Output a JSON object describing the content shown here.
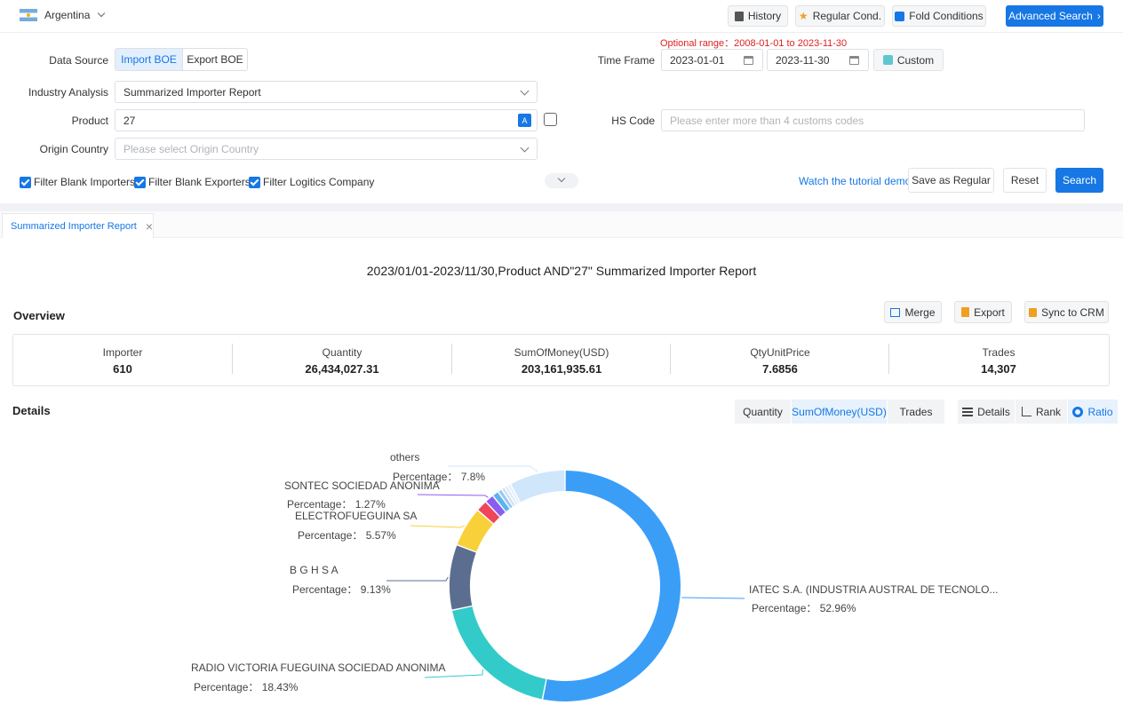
{
  "topbar": {
    "country": "Argentina",
    "buttons": {
      "history": "History",
      "regular": "Regular Cond.",
      "fold": "Fold Conditions",
      "advanced": "Advanced Search"
    }
  },
  "form": {
    "optional_range": "Optional range：2008-01-01 to 2023-11-30",
    "data_source_label": "Data Source",
    "import_boe": "Import BOE",
    "export_boe": "Export BOE",
    "time_frame_label": "Time Frame",
    "date_from": "2023-01-01",
    "date_to": "2023-11-30",
    "custom": "Custom",
    "industry_label": "Industry Analysis",
    "industry_value": "Summarized Importer Report",
    "product_label": "Product",
    "product_value": "27",
    "hs_label": "HS Code",
    "hs_placeholder": "Please enter more than 4 customs codes",
    "origin_label": "Origin Country",
    "origin_placeholder": "Please select Origin Country",
    "filters": [
      "Filter Blank Importers",
      "Filter Blank Exporters",
      "Filter Logitics Company"
    ],
    "tutorial": "Watch the tutorial demo",
    "save_regular": "Save as Regular",
    "reset": "Reset",
    "search": "Search"
  },
  "tab": {
    "label": "Summarized Importer Report",
    "close": "×"
  },
  "report": {
    "title": "2023/01/01-2023/11/30,Product AND\"27\" Summarized Importer Report",
    "overview_heading": "Overview",
    "merge": "Merge",
    "export": "Export",
    "sync": "Sync to CRM",
    "stats": [
      {
        "label": "Importer",
        "value": "610"
      },
      {
        "label": "Quantity",
        "value": "26,434,027.31"
      },
      {
        "label": "SumOfMoney(USD)",
        "value": "203,161,935.61"
      },
      {
        "label": "QtyUnitPrice",
        "value": "7.6856"
      },
      {
        "label": "Trades",
        "value": "14,307"
      }
    ],
    "details_heading": "Details",
    "metric_tabs": [
      "Quantity",
      "SumOfMoney(USD)",
      "Trades"
    ],
    "view_tabs": [
      "Details",
      "Rank",
      "Ratio"
    ]
  },
  "chart_data": {
    "type": "pie",
    "variant": "donut",
    "start_angle_deg": 90,
    "slices": [
      {
        "name": "IATEC S.A. (INDUSTRIA AUSTRAL DE TECNOLO...",
        "value": 52.96,
        "pct_label": "Percentage：  52.96%",
        "color": "#3a9ef7"
      },
      {
        "name": "RADIO VICTORIA FUEGUINA SOCIEDAD ANONIMA",
        "value": 18.43,
        "pct_label": "Percentage：  18.43%",
        "color": "#33cbc9"
      },
      {
        "name": "B G H S A",
        "value": 9.13,
        "pct_label": "Percentage：  9.13%",
        "color": "#5b6e8f"
      },
      {
        "name": "ELECTROFUEGUINA SA",
        "value": 5.57,
        "pct_label": "Percentage：  5.57%",
        "color": "#f8d13a"
      },
      {
        "name": "",
        "value": 1.6,
        "pct_label": "",
        "color": "#f0455a"
      },
      {
        "name": "SONTEC SOCIEDAD ANONIMA",
        "value": 1.27,
        "pct_label": "Percentage：  1.27%",
        "color": "#8b5cf0"
      },
      {
        "name": "",
        "value": 0.9,
        "pct_label": "",
        "color": "#5ab5ef"
      },
      {
        "name": "",
        "value": 0.6,
        "pct_label": "",
        "color": "#9cc7f2"
      },
      {
        "name": "",
        "value": 0.5,
        "pct_label": "",
        "color": "#cde1f5"
      },
      {
        "name": "",
        "value": 0.45,
        "pct_label": "",
        "color": "#dbe8f6"
      },
      {
        "name": "",
        "value": 0.45,
        "pct_label": "",
        "color": "#e4eef8"
      },
      {
        "name": "others",
        "value": 7.8,
        "pct_label": "Percentage：  7.8%",
        "color": "#cfe6fb"
      }
    ]
  }
}
